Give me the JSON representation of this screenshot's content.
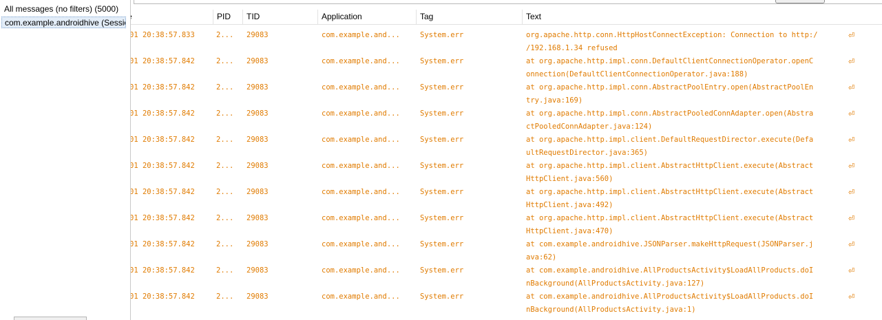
{
  "filters": {
    "all_messages": "All messages (no filters) (5000)",
    "app_filter": "com.example.androidhive (Sessio"
  },
  "columns": {
    "time": "e",
    "pid": "PID",
    "tid": "TID",
    "application": "Application",
    "tag": "Tag",
    "text": "Text"
  },
  "rows": [
    {
      "time": "01 20:38:57.833",
      "pid": "2...",
      "tid": "29083",
      "app": "com.example.and...",
      "tag": "System.err",
      "text1": "org.apache.http.conn.HttpHostConnectException: Connection to http:/",
      "text2": "/192.168.1.34 refused"
    },
    {
      "time": "01 20:38:57.842",
      "pid": "2...",
      "tid": "29083",
      "app": "com.example.and...",
      "tag": "System.err",
      "text1": "at org.apache.http.impl.conn.DefaultClientConnectionOperator.openC",
      "text2": "onnection(DefaultClientConnectionOperator.java:188)"
    },
    {
      "time": "01 20:38:57.842",
      "pid": "2...",
      "tid": "29083",
      "app": "com.example.and...",
      "tag": "System.err",
      "text1": "at org.apache.http.impl.conn.AbstractPoolEntry.open(AbstractPoolEn",
      "text2": "try.java:169)"
    },
    {
      "time": "01 20:38:57.842",
      "pid": "2...",
      "tid": "29083",
      "app": "com.example.and...",
      "tag": "System.err",
      "text1": "at org.apache.http.impl.conn.AbstractPooledConnAdapter.open(Abstra",
      "text2": "ctPooledConnAdapter.java:124)"
    },
    {
      "time": "01 20:38:57.842",
      "pid": "2...",
      "tid": "29083",
      "app": "com.example.and...",
      "tag": "System.err",
      "text1": "at org.apache.http.impl.client.DefaultRequestDirector.execute(Defa",
      "text2": "ultRequestDirector.java:365)"
    },
    {
      "time": "01 20:38:57.842",
      "pid": "2...",
      "tid": "29083",
      "app": "com.example.and...",
      "tag": "System.err",
      "text1": "at org.apache.http.impl.client.AbstractHttpClient.execute(Abstract",
      "text2": "HttpClient.java:560)"
    },
    {
      "time": "01 20:38:57.842",
      "pid": "2...",
      "tid": "29083",
      "app": "com.example.and...",
      "tag": "System.err",
      "text1": "at org.apache.http.impl.client.AbstractHttpClient.execute(Abstract",
      "text2": "HttpClient.java:492)"
    },
    {
      "time": "01 20:38:57.842",
      "pid": "2...",
      "tid": "29083",
      "app": "com.example.and...",
      "tag": "System.err",
      "text1": "at org.apache.http.impl.client.AbstractHttpClient.execute(Abstract",
      "text2": "HttpClient.java:470)"
    },
    {
      "time": "01 20:38:57.842",
      "pid": "2...",
      "tid": "29083",
      "app": "com.example.and...",
      "tag": "System.err",
      "text1": "at com.example.androidhive.JSONParser.makeHttpRequest(JSONParser.j",
      "text2": "ava:62)"
    },
    {
      "time": "01 20:38:57.842",
      "pid": "2...",
      "tid": "29083",
      "app": "com.example.and...",
      "tag": "System.err",
      "text1": "at com.example.androidhive.AllProductsActivity$LoadAllProducts.doI",
      "text2": "nBackground(AllProductsActivity.java:127)"
    },
    {
      "time": "01 20:38:57.842",
      "pid": "2...",
      "tid": "29083",
      "app": "com.example.and...",
      "tag": "System.err",
      "text1": "at com.example.androidhive.AllProductsActivity$LoadAllProducts.doI",
      "text2": "nBackground(AllProductsActivity.java:1)"
    }
  ],
  "wrap_icon": "wrap-arrow-icon",
  "colors": {
    "log_text": "#e07b00",
    "selected_filter_bg": "#e3edf8"
  }
}
